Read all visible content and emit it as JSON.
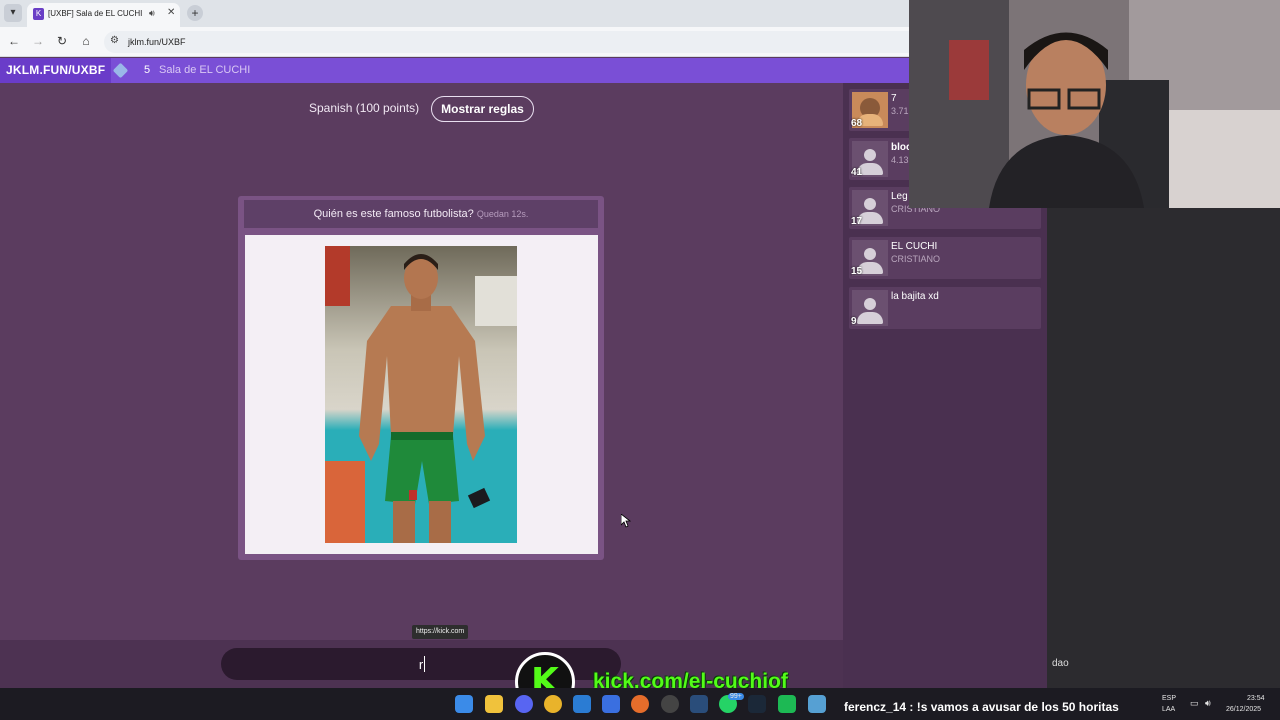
{
  "browser": {
    "tab_title": "[UXBF] Sala de EL CUCHI",
    "url": "jklm.fun/UXBF"
  },
  "header": {
    "room_code": "JKLM.FUN/UXBF",
    "player_count": "5",
    "room_name": "Sala de EL CUCHI"
  },
  "game": {
    "language_label": "Spanish (100 points)",
    "rules_button": "Mostrar reglas",
    "question": "Quién es este famoso futbolista?",
    "timer": "Quedan 12s."
  },
  "input": {
    "value": "r",
    "tooltip": "https://kick.com"
  },
  "players": [
    {
      "score": "68",
      "name": "7",
      "sub": "3.71"
    },
    {
      "score": "41",
      "name": "bloc",
      "sub": "4.13"
    },
    {
      "score": "17",
      "name": "Leg",
      "sub": "CRISTIANO"
    },
    {
      "score": "15",
      "name": "EL CUCHI",
      "sub": "CRISTIANO"
    },
    {
      "score": "9",
      "name": "la bajita xd",
      "sub": ""
    }
  ],
  "chat": {
    "input_text": "dao"
  },
  "overlay": {
    "kick_url": "kick.com/el-cuchiof",
    "ticker": "ferencz_14 : !s vamos a avusar de los 50 horitas"
  },
  "taskbar": {
    "lang": "ESP",
    "layout": "LAA",
    "time": "23:54",
    "date": "26/12/2025",
    "badge": "99+"
  },
  "colors": {
    "accent": "#7a4fd6",
    "background": "#5b3c5f",
    "kick_green": "#53fc18"
  }
}
